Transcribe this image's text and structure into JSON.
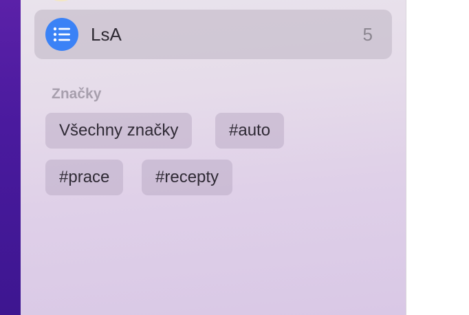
{
  "list": {
    "name": "LsA",
    "count": "5",
    "icon": "list-bullet-icon",
    "icon_color": "#3b82f6"
  },
  "tags_section": {
    "title": "Značky",
    "tags": [
      {
        "label": "Všechny značky"
      },
      {
        "label": "#auto"
      },
      {
        "label": "#prace"
      },
      {
        "label": "#recepty"
      }
    ]
  }
}
